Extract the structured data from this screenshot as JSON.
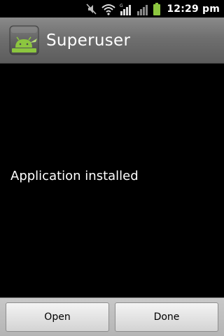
{
  "status_bar": {
    "time": "12:29 pm",
    "icons": [
      "mute-icon",
      "wifi-icon",
      "signal-g-icon",
      "signal-icon",
      "battery-icon"
    ],
    "network_type": "G",
    "battery_color": "#8cc63f"
  },
  "title_bar": {
    "title": "Superuser",
    "icon": "superuser-android-icon"
  },
  "body": {
    "message": "Application installed"
  },
  "buttons": {
    "open_label": "Open",
    "done_label": "Done"
  },
  "colors": {
    "background": "#000000",
    "title_bar": "#6f6f6f",
    "text": "#ffffff",
    "android_green": "#8cc63f"
  }
}
